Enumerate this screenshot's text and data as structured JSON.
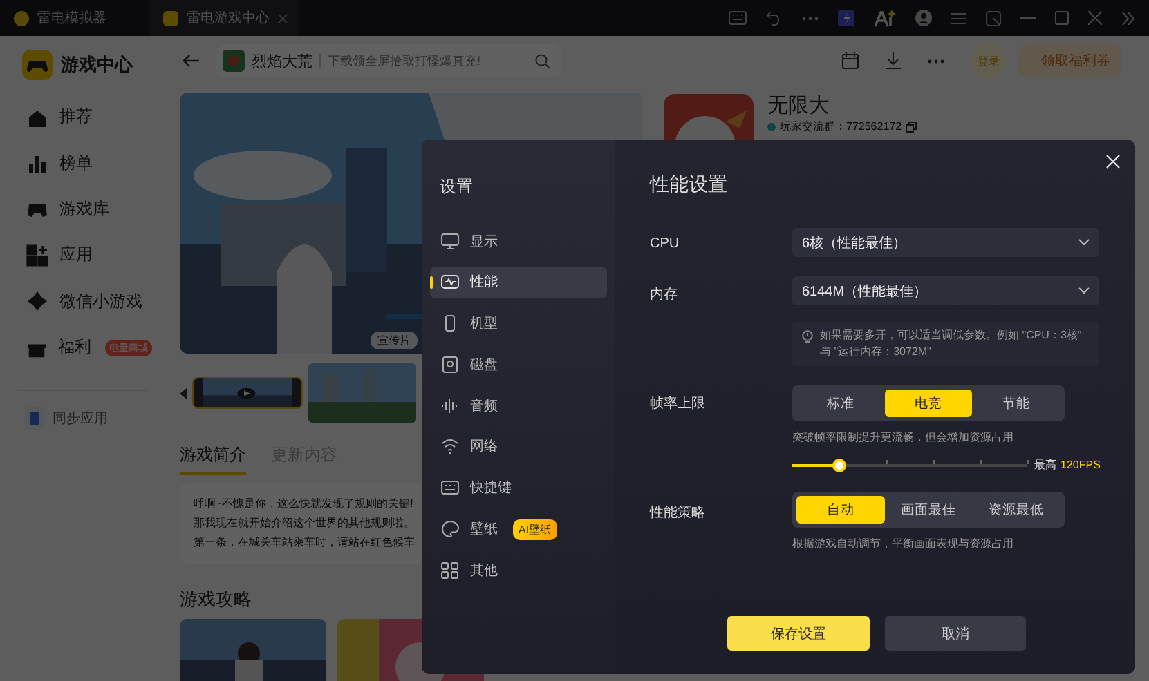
{
  "titlebar": {
    "tabs": [
      {
        "label": "雷电模拟器",
        "selected": false
      },
      {
        "label": "雷电游戏中心",
        "selected": true
      }
    ]
  },
  "header": {
    "title": "游戏中心",
    "search": {
      "game": "烈焰大荒",
      "tagline": "下载领全屏拾取打怪爆真充!"
    },
    "login": "登录",
    "coupon": "领取福利券"
  },
  "sidebar": {
    "items": [
      {
        "label": "推荐"
      },
      {
        "label": "榜单"
      },
      {
        "label": "游戏库"
      },
      {
        "label": "应用"
      },
      {
        "label": "微信小游戏"
      },
      {
        "label": "福利",
        "badge": "电量商城"
      }
    ],
    "sync": "同步应用"
  },
  "game": {
    "banner_tag": "宣传片",
    "title": "无限大",
    "group": "玩家交流群：772562172",
    "tabs": [
      {
        "label": "游戏简介",
        "selected": true
      },
      {
        "label": "更新内容",
        "selected": false
      }
    ],
    "intro": [
      "呼啊~不愧是你，这么快就发现了规则的关键!",
      "那我现在就开始介绍这个世界的其他规则啦。",
      "第一条，在城关车站乘车时，请站在红色候车"
    ],
    "guide_heading": "游戏攻略"
  },
  "settings": {
    "title": "设置",
    "nav": [
      {
        "label": "显示",
        "selected": false
      },
      {
        "label": "性能",
        "selected": true
      },
      {
        "label": "机型",
        "selected": false
      },
      {
        "label": "磁盘",
        "selected": false
      },
      {
        "label": "音频",
        "selected": false
      },
      {
        "label": "网络",
        "selected": false
      },
      {
        "label": "快捷键",
        "selected": false
      },
      {
        "label": "壁纸",
        "selected": false,
        "badge": "AI壁纸"
      },
      {
        "label": "其他",
        "selected": false
      }
    ],
    "heading": "性能设置",
    "cpu": {
      "label": "CPU",
      "value": "6核（性能最佳）"
    },
    "memory": {
      "label": "内存",
      "value": "6144M（性能最佳）",
      "hint": "如果需要多开，可以适当调低参数。例如 \"CPU：3核\" 与 \"运行内存：3072M\""
    },
    "fps": {
      "label": "帧率上限",
      "options": [
        {
          "label": "标准",
          "selected": false
        },
        {
          "label": "电竞",
          "selected": true
        },
        {
          "label": "节能",
          "selected": false
        }
      ],
      "hint": "突破帧率限制提升更流畅，但会增加资源占用",
      "level": 0.2,
      "max_label": "最高",
      "max_value": "120FPS"
    },
    "strategy": {
      "label": "性能策略",
      "options": [
        {
          "label": "自动",
          "selected": true
        },
        {
          "label": "画面最佳",
          "selected": false
        },
        {
          "label": "资源最低",
          "selected": false
        }
      ],
      "hint": "根据游戏自动调节，平衡画面表现与资源占用"
    },
    "save": "保存设置",
    "cancel": "取消"
  }
}
